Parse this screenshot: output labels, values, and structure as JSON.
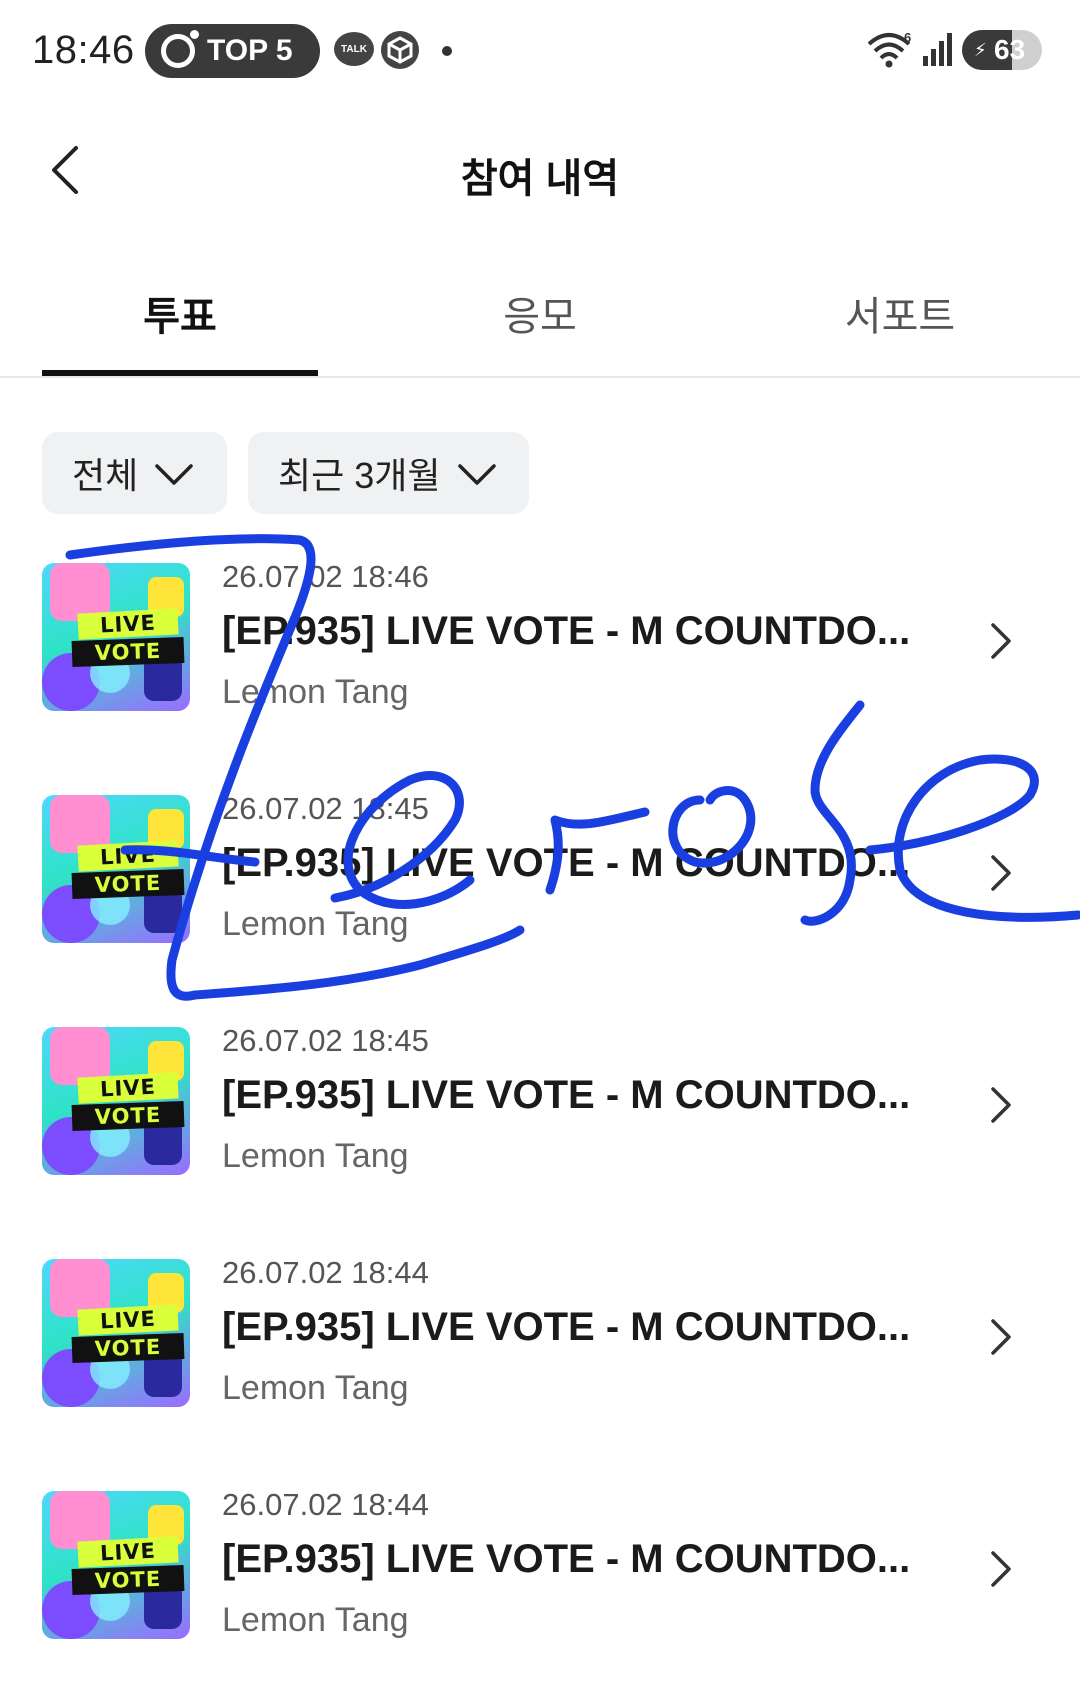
{
  "status_bar": {
    "time": "18:46",
    "notification_pill": "TOP 5",
    "talk_badge": "TALK",
    "wifi_icon": "wifi-icon",
    "wifi_badge": "6",
    "signal_icon": "signal-icon",
    "battery_level": "63",
    "battery_fraction": 0.63
  },
  "header": {
    "title": "참여 내역",
    "back_icon": "chevron-left-icon"
  },
  "tabs": [
    {
      "label": "투표",
      "active": true
    },
    {
      "label": "응모",
      "active": false
    },
    {
      "label": "서포트",
      "active": false
    }
  ],
  "filters": {
    "category": "전체",
    "period": "최근 3개월"
  },
  "items": [
    {
      "time": "26.07.02 18:46",
      "title": "[EP.935] LIVE VOTE - M COUNTDO...",
      "subtitle": "Lemon Tang",
      "thumb_line1": "LIVE",
      "thumb_line2": "VOTE"
    },
    {
      "time": "26.07.02 18:45",
      "title": "[EP.935] LIVE VOTE - M COUNTDO...",
      "subtitle": "Lemon Tang",
      "thumb_line1": "LIVE",
      "thumb_line2": "VOTE"
    },
    {
      "time": "26.07.02 18:45",
      "title": "[EP.935] LIVE VOTE - M COUNTDO...",
      "subtitle": "Lemon Tang",
      "thumb_line1": "LIVE",
      "thumb_line2": "VOTE"
    },
    {
      "time": "26.07.02 18:44",
      "title": "[EP.935] LIVE VOTE - M COUNTDO...",
      "subtitle": "Lemon Tang",
      "thumb_line1": "LIVE",
      "thumb_line2": "VOTE"
    },
    {
      "time": "26.07.02 18:44",
      "title": "[EP.935] LIVE VOTE - M COUNTDO...",
      "subtitle": "Lemon Tang",
      "thumb_line1": "LIVE",
      "thumb_line2": "VOTE"
    }
  ],
  "overlay": {
    "signature_color": "#1a3fe0"
  },
  "colors": {
    "accent": "#111111",
    "filter_bg": "#f0f1f3"
  }
}
